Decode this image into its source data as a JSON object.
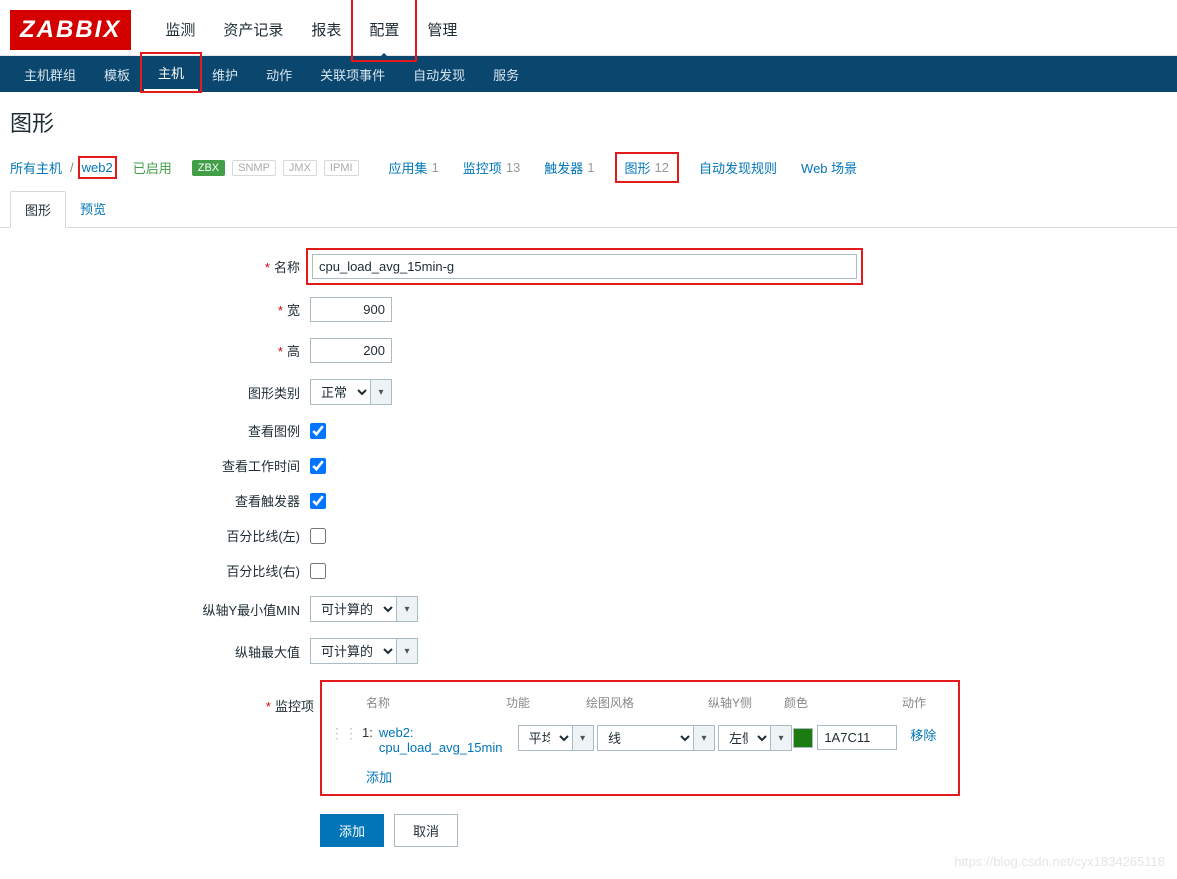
{
  "logo": "ZABBIX",
  "topnav": {
    "items": [
      "监测",
      "资产记录",
      "报表",
      "配置",
      "管理"
    ],
    "active_index": 3
  },
  "subnav": {
    "items": [
      "主机群组",
      "模板",
      "主机",
      "维护",
      "动作",
      "关联项事件",
      "自动发现",
      "服务"
    ],
    "active_index": 2
  },
  "page_title": "图形",
  "hostrow": {
    "all_hosts": "所有主机",
    "host": "web2",
    "status": "已启用",
    "badges": {
      "zbx": "ZBX",
      "snmp": "SNMP",
      "jmx": "JMX",
      "ipmi": "IPMI"
    },
    "app": {
      "label": "应用集",
      "count": "1"
    },
    "items": {
      "label": "监控项",
      "count": "13"
    },
    "triggers": {
      "label": "触发器",
      "count": "1"
    },
    "graphs": {
      "label": "图形",
      "count": "12"
    },
    "discovery": "自动发现规则",
    "web": "Web 场景"
  },
  "tabs": {
    "graph": "图形",
    "preview": "预览",
    "active_index": 0
  },
  "form": {
    "name": {
      "label": "名称",
      "value": "cpu_load_avg_15min-g"
    },
    "width": {
      "label": "宽",
      "value": "900"
    },
    "height": {
      "label": "高",
      "value": "200"
    },
    "type": {
      "label": "图形类别",
      "value": "正常"
    },
    "legend": {
      "label": "查看图例",
      "checked": true
    },
    "worktime": {
      "label": "查看工作时间",
      "checked": true
    },
    "triggers": {
      "label": "查看触发器",
      "checked": true
    },
    "percent_left": {
      "label": "百分比线(左)",
      "checked": false
    },
    "percent_right": {
      "label": "百分比线(右)",
      "checked": false
    },
    "ymin": {
      "label": "纵轴Y最小值MIN",
      "value": "可计算的"
    },
    "ymax": {
      "label": "纵轴最大值",
      "value": "可计算的"
    },
    "items_section": {
      "label": "监控项",
      "head": {
        "name": "名称",
        "func": "功能",
        "drawtype": "绘图风格",
        "yaxis": "纵轴Y侧",
        "color": "颜色",
        "action": "动作"
      },
      "row": {
        "index": "1:",
        "name_host": "web2:",
        "name_key": "cpu_load_avg_15min",
        "func": "平均",
        "drawtype": "线",
        "yaxis": "左侧",
        "color_hex": "1A7C11",
        "remove": "移除"
      },
      "add": "添加"
    }
  },
  "footer": {
    "add": "添加",
    "cancel": "取消"
  },
  "watermark": "https://blog.csdn.net/cyx1834265118"
}
